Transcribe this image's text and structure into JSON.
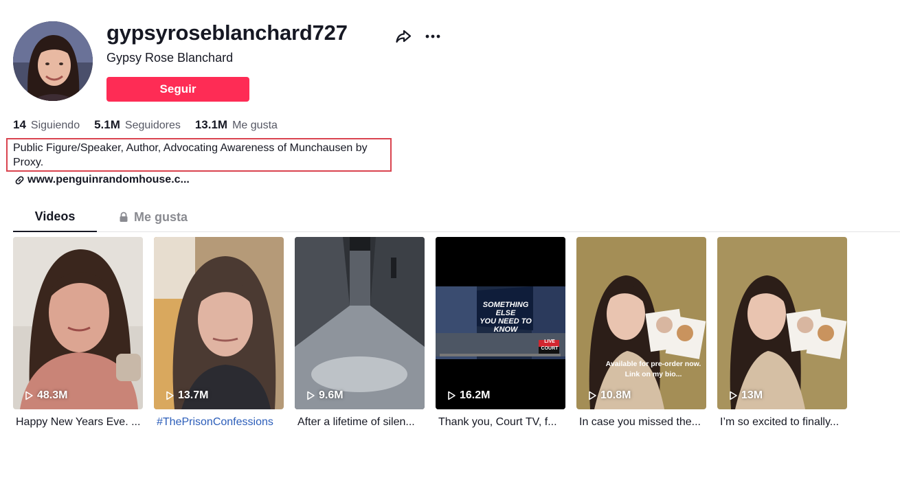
{
  "profile": {
    "username": "gypsyroseblanchard727",
    "nickname": "Gypsy Rose Blanchard",
    "follow_label": "Seguir",
    "bio": "Public Figure/Speaker, Author, Advocating Awareness of Munchausen by Proxy.",
    "link": "www.penguinrandomhouse.c..."
  },
  "stats": [
    {
      "num": "14",
      "label": "Siguiendo"
    },
    {
      "num": "5.1M",
      "label": "Seguidores"
    },
    {
      "num": "13.1M",
      "label": "Me gusta"
    }
  ],
  "tabs": {
    "videos": "Videos",
    "likes": "Me gusta"
  },
  "videos": [
    {
      "views": "48.3M",
      "caption": "Happy New Years Eve. ..."
    },
    {
      "views": "13.7M",
      "caption": "#ThePrisonConfessions"
    },
    {
      "views": "9.6M",
      "caption": "After a lifetime of silen..."
    },
    {
      "views": "16.2M",
      "caption": "Thank you, Court TV, f..."
    },
    {
      "views": "10.8M",
      "caption": "In case you missed the...",
      "overlay": [
        "Available for pre-order now.",
        "Link on my bio..."
      ]
    },
    {
      "views": "13M",
      "caption": "I’m so excited to finally..."
    }
  ],
  "video4_overlay": {
    "line1": "SOMETHING ELSE",
    "line2": "YOU NEED TO KNOW",
    "live": "LIVE",
    "court": "COURT"
  },
  "colors": {
    "accent": "#fe2c55",
    "highlight_box": "#d9434e",
    "hashtag": "#2b5db9"
  }
}
